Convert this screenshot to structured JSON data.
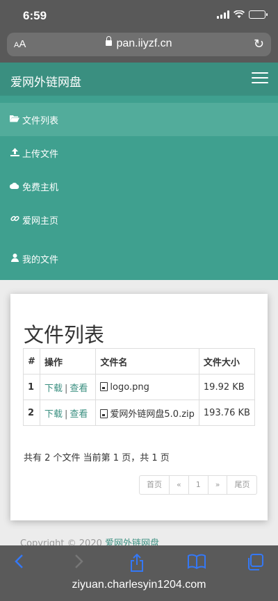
{
  "status": {
    "time": "6:59"
  },
  "browser": {
    "aa_small": "A",
    "aa_large": "A",
    "url": "pan.iiyzf.cn"
  },
  "navbar": {
    "brand": "爱网外链网盘"
  },
  "menu": {
    "items": [
      {
        "label": "文件列表",
        "icon": "folder-open-icon",
        "active": true
      },
      {
        "label": "上传文件",
        "icon": "upload-icon"
      },
      {
        "label": "免费主机",
        "icon": "cloud-icon"
      },
      {
        "label": "爱网主页",
        "icon": "link-icon"
      },
      {
        "label": "我的文件",
        "icon": "user-icon"
      }
    ]
  },
  "panel": {
    "title": "文件列表",
    "table": {
      "headers": [
        "#",
        "操作",
        "文件名",
        "文件大小"
      ],
      "rows": [
        {
          "num": "1",
          "download": "下载",
          "sep": "|",
          "view": "查看",
          "name": "logo.png",
          "size": "19.92 KB"
        },
        {
          "num": "2",
          "download": "下载",
          "sep": "|",
          "view": "查看",
          "name": "爱网外链网盘5.0.zip",
          "size": "193.76 KB"
        }
      ]
    },
    "summary": "共有 2 个文件  当前第 1 页，共 1 页",
    "pager": {
      "first": "首页",
      "prev": "«",
      "current": "1",
      "next": "»",
      "last": "尾页"
    }
  },
  "footer": {
    "copyright_prefix": "Copyright © 2020 ",
    "copyright_link": "爱网外链网盘"
  },
  "watermark": "ziyuan.charlesyin1204.com",
  "colors": {
    "theme": "#3fa08f",
    "link": "#3a8f80",
    "ios_accent": "#3478f6"
  }
}
